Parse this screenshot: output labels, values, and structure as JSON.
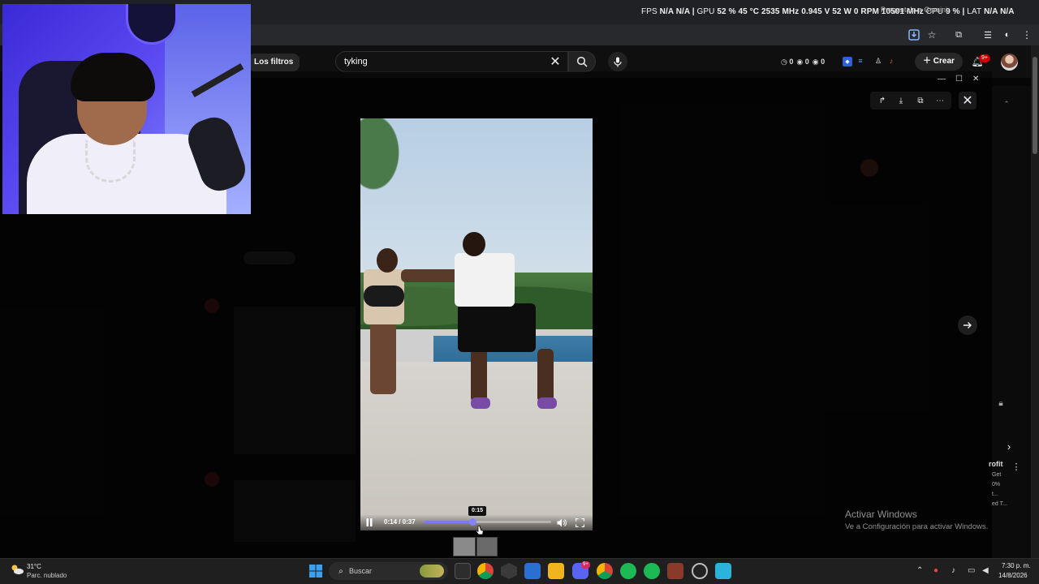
{
  "overlay_stats": {
    "fps_label": "FPS",
    "fps_value": "N/A",
    "fps_value2": "N/A",
    "gpu_label": "GPU",
    "gpu_stats": "52 % 45 °C 2535 MHz 0.945 V 52 W 0 RPM 10501 MHz",
    "cpu_label": "CPU",
    "cpu_value": "9 %",
    "lat_label": "LAT",
    "lat_value": "N/A",
    "lat_value2": "N/A"
  },
  "tab_hint": "Preguntale a Gemini",
  "youtube": {
    "filter_chip": "Los filtros",
    "search_value": "tyking",
    "counters": [
      "0",
      "0",
      "0"
    ],
    "create_label": "Crear",
    "notif_badge": "9+"
  },
  "video": {
    "time_text": "0:14 / 0:37",
    "hover_time": "0:15",
    "progress_fraction": 0.38
  },
  "right_panel": {
    "profit_label": "rofit",
    "profit_sub": [
      "Get",
      "0%",
      "t...",
      "ed T..."
    ]
  },
  "watermark": {
    "title": "Activar Windows",
    "subtitle": "Ve a Configuración para activar Windows."
  },
  "taskbar": {
    "weather_temp": "31°C",
    "weather_desc": "Parc. nublado",
    "search_label": "Buscar",
    "discord_badge": "9+",
    "time": "7:30 p. m.",
    "date": "14/8/2026"
  },
  "colors": {
    "accent": "#7b78ff",
    "notif_red": "#cc0000"
  }
}
